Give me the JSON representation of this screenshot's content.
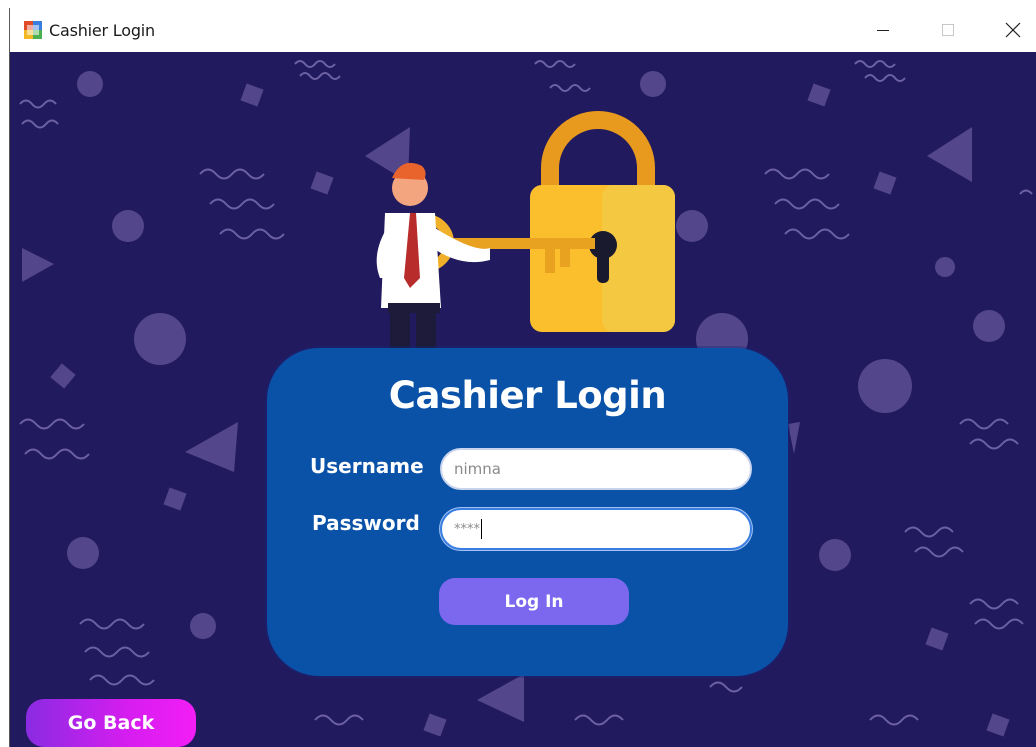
{
  "window": {
    "title": "Cashier Login"
  },
  "login": {
    "heading": "Cashier Login",
    "username_label": "Username",
    "password_label": "Password",
    "username_value": "nimna",
    "password_value": "****",
    "login_button": "Log In"
  },
  "navigation": {
    "go_back_button": "Go Back"
  },
  "colors": {
    "background": "#221a5f",
    "card": "#0a52a8",
    "login_button": "#7b68ee",
    "go_back_gradient": [
      "#8a2be2",
      "#f21ef5"
    ]
  },
  "icons": [
    "app-icon",
    "minimize-icon",
    "maximize-icon",
    "close-icon",
    "padlock-icon",
    "key-icon"
  ]
}
